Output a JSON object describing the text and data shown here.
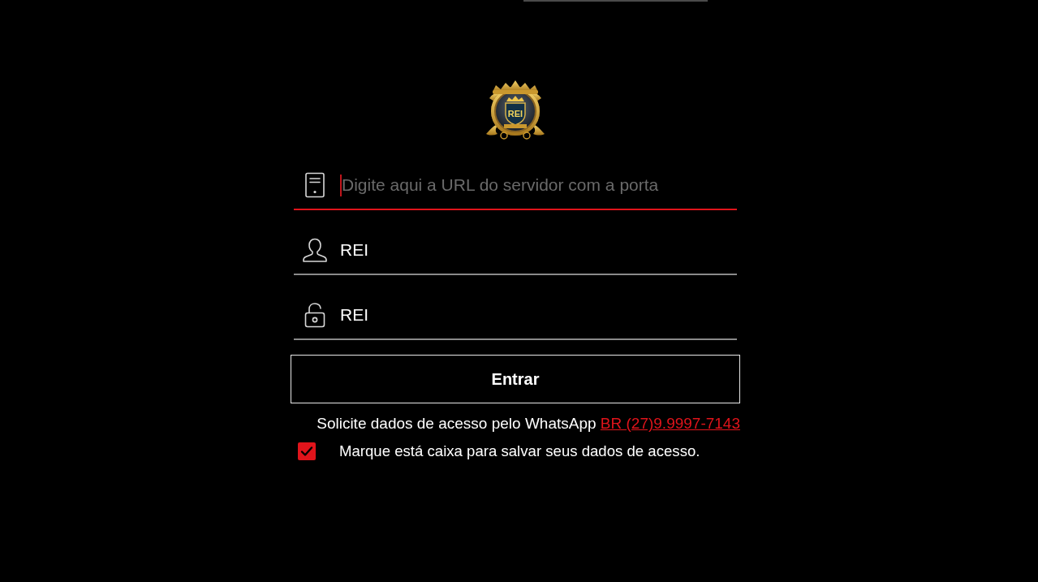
{
  "logo": {
    "text": "REI"
  },
  "fields": [
    {
      "kind": "server",
      "placeholder": "Digite aqui a URL do servidor com a porta",
      "focused": true
    },
    {
      "kind": "user",
      "value": "REI",
      "focused": false
    },
    {
      "kind": "password",
      "value": "REI",
      "focused": false
    }
  ],
  "login_button": {
    "label": "Entrar"
  },
  "whatsapp": {
    "text": "Solicite dados de acesso pelo WhatsApp",
    "link": "BR (27)9.9997-7143"
  },
  "remember": {
    "label": "Marque está caixa para salvar seus dados de acesso.",
    "checked": true
  }
}
